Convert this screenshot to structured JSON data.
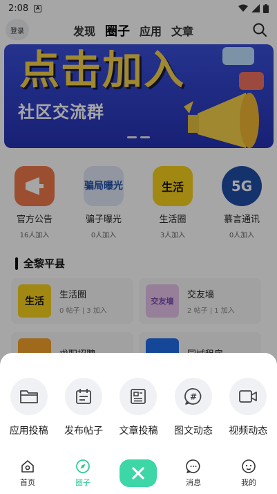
{
  "status": {
    "time": "2:08",
    "a_icon": "A"
  },
  "header": {
    "login": "登录",
    "tabs": [
      {
        "label": "发现"
      },
      {
        "label": "圈子"
      },
      {
        "label": "应用"
      },
      {
        "label": "文章"
      }
    ],
    "active_tab": "圈子"
  },
  "banner": {
    "headline": "点击加入",
    "subtitle": "社区交流群"
  },
  "circles": [
    {
      "name": "官方公告",
      "count": "16人加入",
      "color": "#f07a4a",
      "glyph": "📢"
    },
    {
      "name": "骗子曝光",
      "count": "0人加入",
      "color": "#dfe7f7",
      "glyph": "骗局曝光"
    },
    {
      "name": "生活圈",
      "count": "3人加入",
      "color": "#f7d21e",
      "glyph": "生活"
    },
    {
      "name": "慕言通讯",
      "count": "0人加入",
      "color": "#1f4fa8",
      "glyph": "5G"
    }
  ],
  "section": {
    "title": "全黎平县"
  },
  "cards": [
    {
      "title": "生活圈",
      "meta": "0 帖子 | 3 加入",
      "color": "#f7d21e",
      "glyph": "生活"
    },
    {
      "title": "交友墙",
      "meta": "2 帖子 | 1 加入",
      "color": "#e9c4ec",
      "glyph": "交友墙"
    },
    {
      "title": "求职招聘",
      "meta": "",
      "color": "#f4a32b",
      "glyph": ""
    },
    {
      "title": "同城租房",
      "meta": "",
      "color": "#1f6ee8",
      "glyph": ""
    }
  ],
  "sheet_actions": [
    {
      "label": "应用投稿",
      "icon": "folder-icon"
    },
    {
      "label": "发布帖子",
      "icon": "calendar-icon"
    },
    {
      "label": "文章投稿",
      "icon": "newspaper-icon"
    },
    {
      "label": "图文动态",
      "icon": "hashtag-chat-icon"
    },
    {
      "label": "视频动态",
      "icon": "video-icon"
    }
  ],
  "nav": {
    "home": "首页",
    "circle": "圈子",
    "messages": "消息",
    "me": "我的"
  },
  "colors": {
    "accent": "#3dd6a6",
    "active_nav": "#2ecb9a"
  }
}
